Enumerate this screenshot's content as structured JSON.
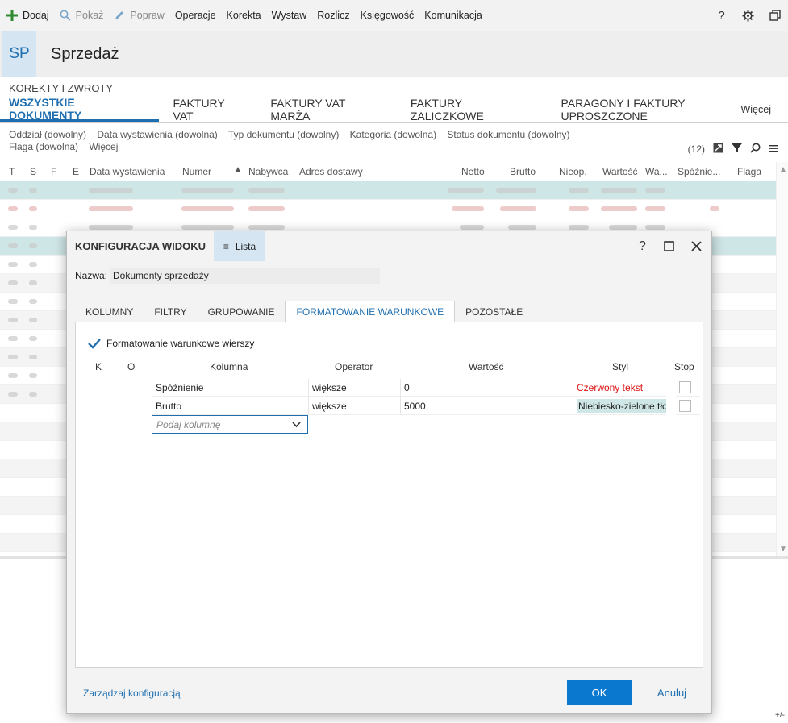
{
  "toolbar": {
    "items": [
      {
        "label": "Dodaj",
        "icon": "plus-icon",
        "color": "#2e8b2e",
        "enabled": true
      },
      {
        "label": "Pokaż",
        "icon": "search-icon",
        "enabled": false
      },
      {
        "label": "Popraw",
        "icon": "pencil-icon",
        "enabled": false
      },
      {
        "label": "Operacje",
        "enabled": true
      },
      {
        "label": "Korekta",
        "enabled": true
      },
      {
        "label": "Wystaw",
        "enabled": true
      },
      {
        "label": "Rozlicz",
        "enabled": true
      },
      {
        "label": "Księgowość",
        "enabled": true
      },
      {
        "label": "Komunikacja",
        "enabled": true
      }
    ],
    "right_icons": [
      "help-icon",
      "gear-icon",
      "restore-window-icon"
    ]
  },
  "app": {
    "badge": "SP",
    "title": "Sprzedaż",
    "section": "KOREKTY I ZWROTY",
    "accent": "#1f6fb0"
  },
  "tabs": [
    {
      "label": "WSZYSTKIE DOKUMENTY",
      "active": true
    },
    {
      "label": "FAKTURY VAT"
    },
    {
      "label": "FAKTURY VAT MARŻA"
    },
    {
      "label": "FAKTURY ZALICZKOWE"
    },
    {
      "label": "PARAGONY I FAKTURY UPROSZCZONE"
    }
  ],
  "tabs_more": "Więcej",
  "filters": {
    "items": [
      "Oddział (dowolny)",
      "Data wystawienia (dowolna)",
      "Typ dokumentu (dowolny)",
      "Kategoria (dowolna)",
      "Status dokumentu (dowolny)",
      "Flaga (dowolna)",
      "Więcej"
    ],
    "count": "(12)"
  },
  "grid": {
    "columns": [
      "T",
      "S",
      "F",
      "E",
      "Data wystawienia",
      "Numer",
      "Nabywca",
      "Adres dostawy",
      "Netto",
      "Brutto",
      "Nieop.",
      "Wartość",
      "Wa...",
      "Spóźnie...",
      "Flaga"
    ]
  },
  "modal": {
    "title": "KONFIGURACJA WIDOKU",
    "list_button": "Lista",
    "name_label": "Nazwa:",
    "name_value": "Dokumenty sprzedaży",
    "tabs": [
      {
        "label": "KOLUMNY"
      },
      {
        "label": "FILTRY"
      },
      {
        "label": "GRUPOWANIE"
      },
      {
        "label": "FORMATOWANIE WARUNKOWE",
        "active": true
      },
      {
        "label": "POZOSTAŁE"
      }
    ],
    "checkbox_label": "Formatowanie warunkowe wierszy",
    "checkbox_checked": true,
    "table_headers": {
      "k": "K",
      "o": "O",
      "kolumna": "Kolumna",
      "operator": "Operator",
      "wartosc": "Wartość",
      "styl": "Styl",
      "stop": "Stop"
    },
    "rules": [
      {
        "column": "Spóźnienie",
        "operator": "większe",
        "value": "0",
        "style": "Czerwony tekst",
        "style_kind": "red"
      },
      {
        "column": "Brutto",
        "operator": "większe",
        "value": "5000",
        "style": "Niebiesko-zielone tło",
        "style_kind": "teal"
      }
    ],
    "column_placeholder": "Podaj kolumnę",
    "manage_link": "Zarządzaj konfiguracją",
    "ok": "OK",
    "cancel": "Anuluj"
  },
  "footer_hint": "+/-"
}
